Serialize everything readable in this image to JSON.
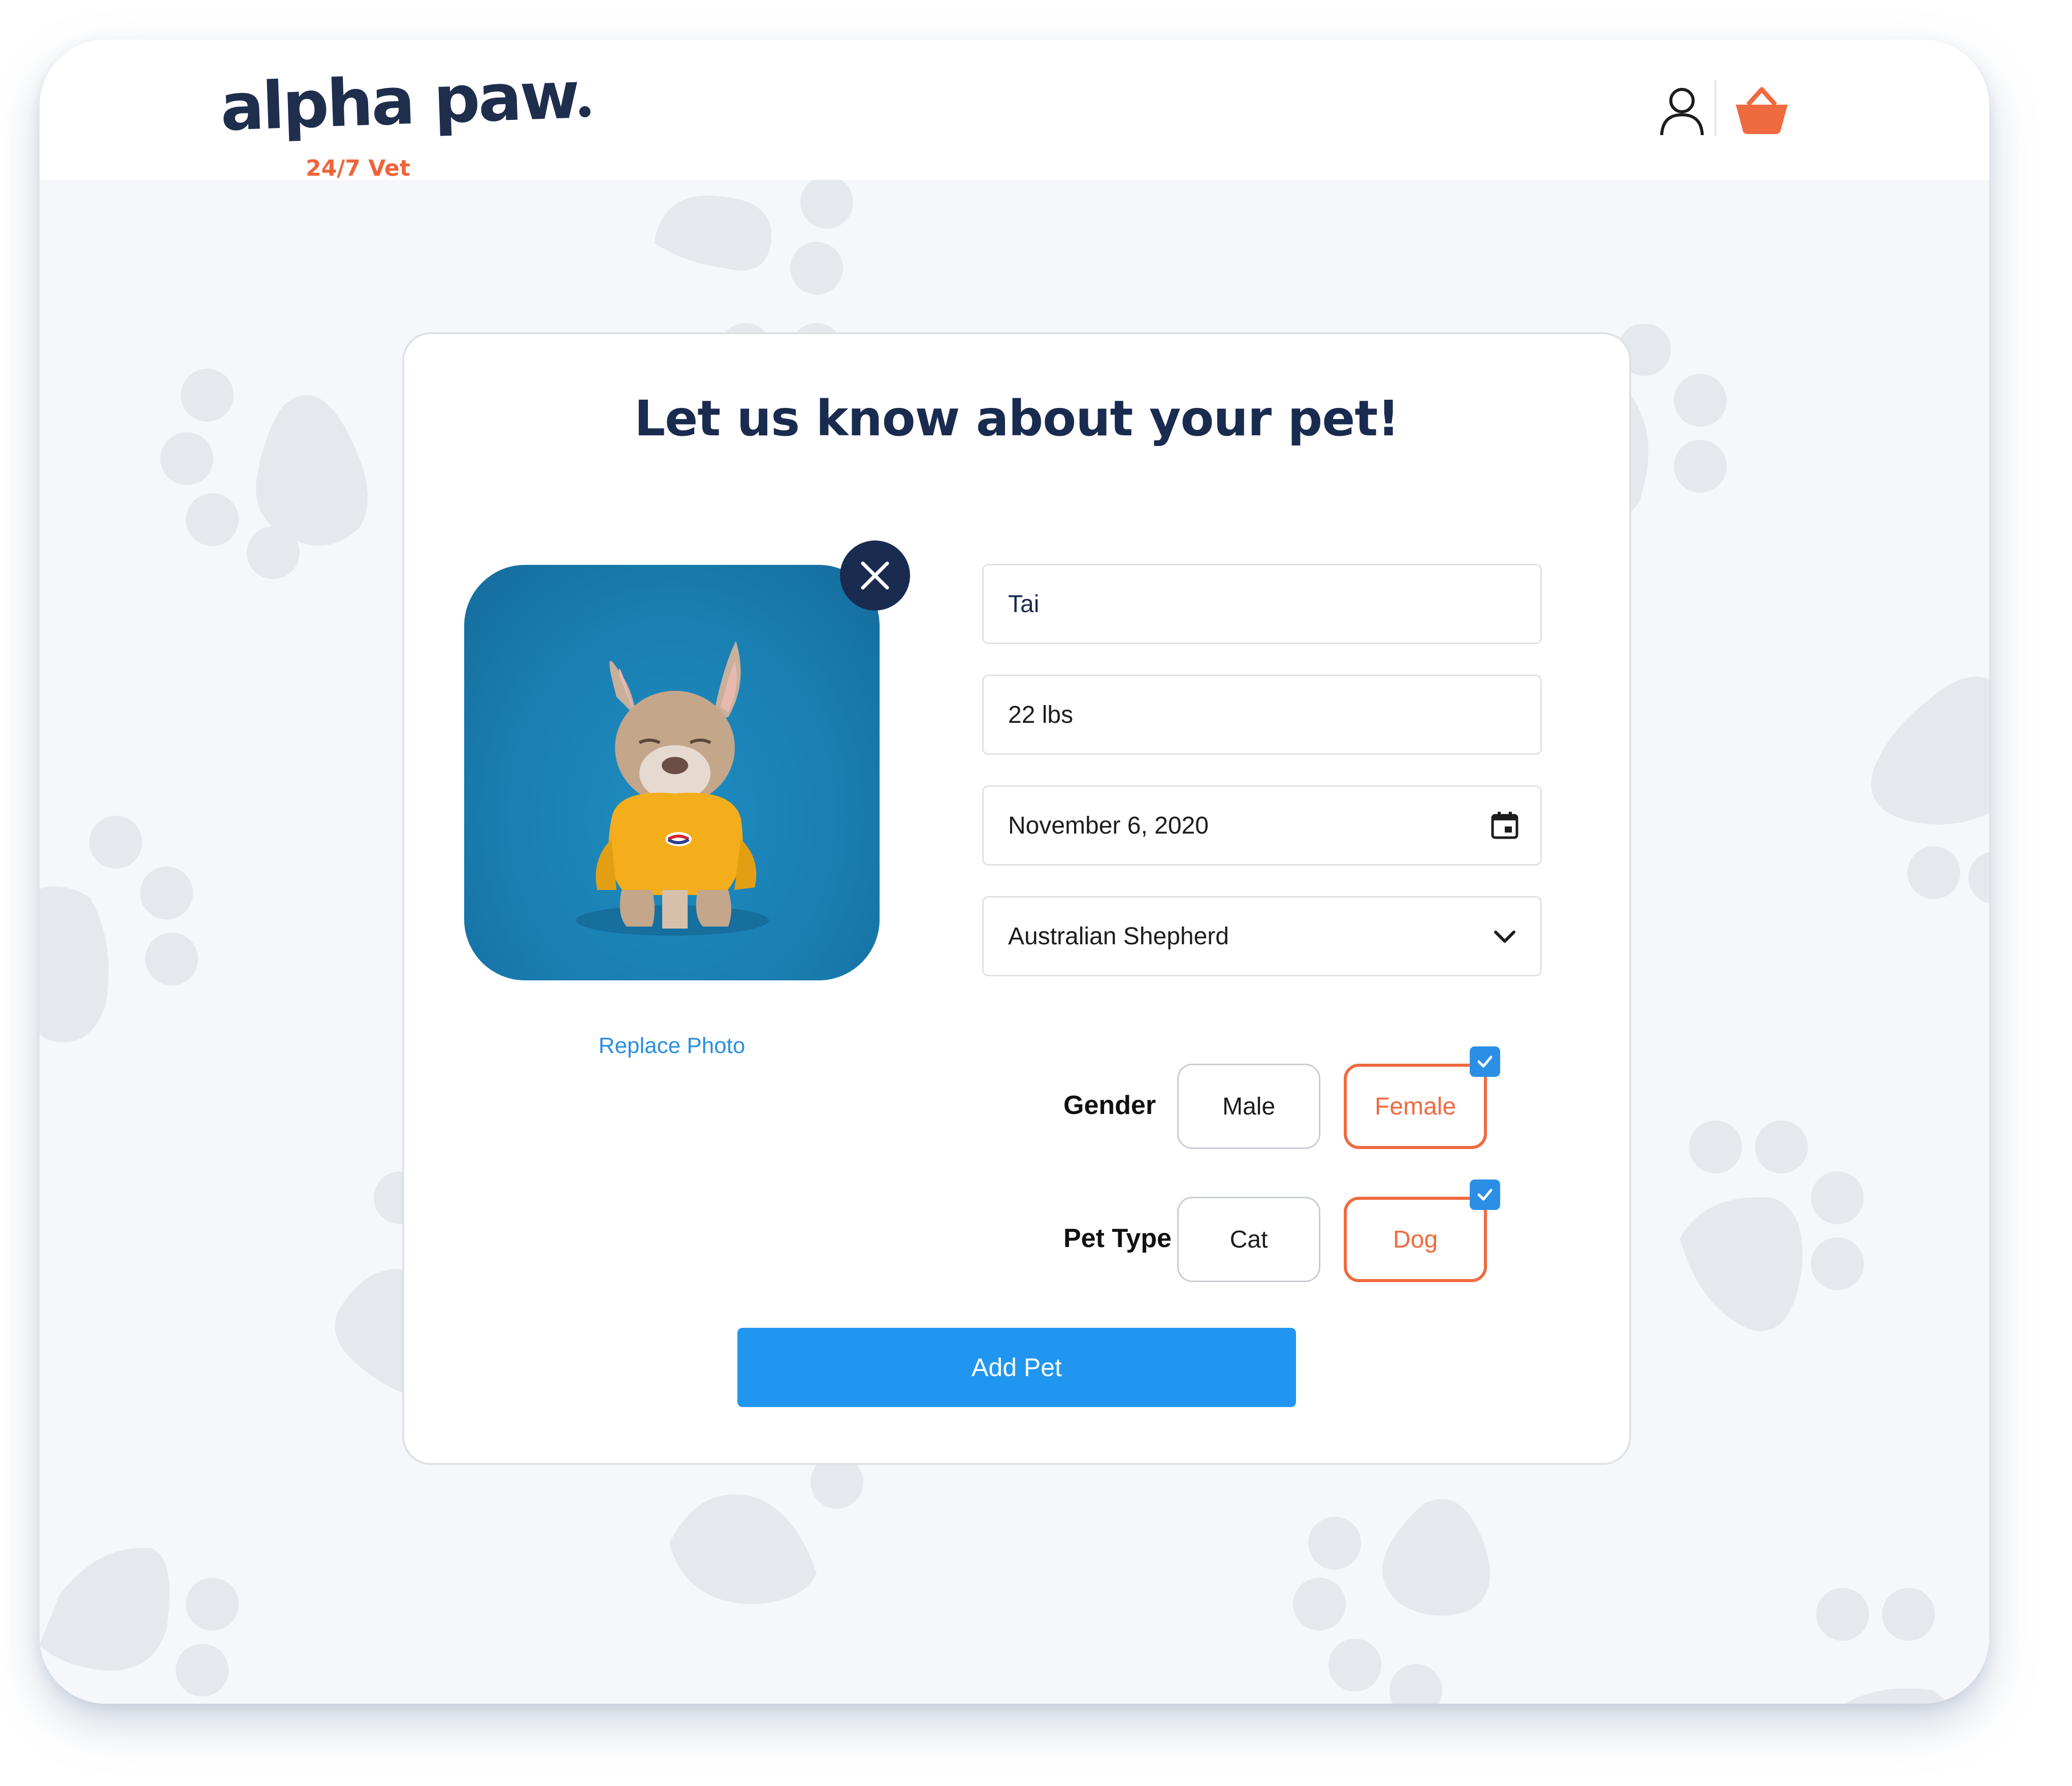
{
  "brand": {
    "name": "alpha paw",
    "tagline": "24/7 Vet"
  },
  "header": {
    "icons": [
      "user-icon",
      "cart-icon"
    ]
  },
  "form": {
    "title": "Let us know about your pet!",
    "photo": {
      "replace_label": "Replace Photo",
      "remove_icon": "close-icon"
    },
    "name_value": "Tai",
    "weight_value": "22 lbs",
    "birthdate_value": "November 6, 2020",
    "breed_value": "Australian Shepherd",
    "gender": {
      "label": "Gender",
      "options": [
        "Male",
        "Female"
      ],
      "selected": "Female"
    },
    "pet_type": {
      "label": "Pet Type",
      "options": [
        "Cat",
        "Dog"
      ],
      "selected": "Dog"
    },
    "submit_label": "Add Pet"
  },
  "colors": {
    "brand_navy": "#1a2b50",
    "accent_orange": "#f06a3f",
    "primary_blue": "#2196f0",
    "link_blue": "#2a8ee0",
    "background": "#f5f7fa"
  }
}
